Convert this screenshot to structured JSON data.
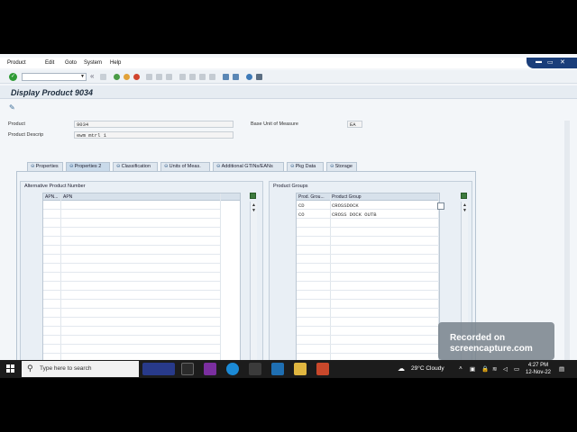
{
  "menu": {
    "items": [
      "Product",
      "Edit",
      "Goto",
      "System",
      "Help"
    ]
  },
  "toolbar": {
    "back_glyph": "«"
  },
  "window": {
    "title": "Display Product 9034"
  },
  "header_fields": {
    "product_label": "Product",
    "product_value": "9034",
    "descr_label": "Product Descrip",
    "descr_value": "ewm mtrl 1",
    "uom_label": "Base Unit of Measure",
    "uom_value": "EA"
  },
  "tabs": [
    {
      "label": "Properties",
      "active": false
    },
    {
      "label": "Properties 2",
      "active": true
    },
    {
      "label": "Classification",
      "active": false
    },
    {
      "label": "Units of Meas.",
      "active": false
    },
    {
      "label": "Additional GTINs/EANs",
      "active": false
    },
    {
      "label": "Pkg Data",
      "active": false
    },
    {
      "label": "Storage",
      "active": false
    }
  ],
  "apn_group": {
    "title": "Alternative Product Number",
    "columns": [
      "APN...",
      "APN"
    ],
    "rows": []
  },
  "product_groups": {
    "title": "Product Groups",
    "columns": [
      "Prod. Grou...",
      "Product Group"
    ],
    "rows": [
      {
        "code": "CD",
        "name": "CROSSDOCK"
      },
      {
        "code": "CO",
        "name": "CROSS DOCK OUTB"
      }
    ]
  },
  "recording_overlay": {
    "line1": "Recorded on",
    "line2": "screencapture.com"
  },
  "taskbar": {
    "search_placeholder": "Type here to search",
    "weather": "29°C  Cloudy",
    "time": "4:27 PM",
    "date": "12-Nov-22"
  },
  "colors": {
    "sap_accent": "#1a3e7a",
    "ok_green": "#2e9b35",
    "taskbar": "#1c1c1c"
  }
}
